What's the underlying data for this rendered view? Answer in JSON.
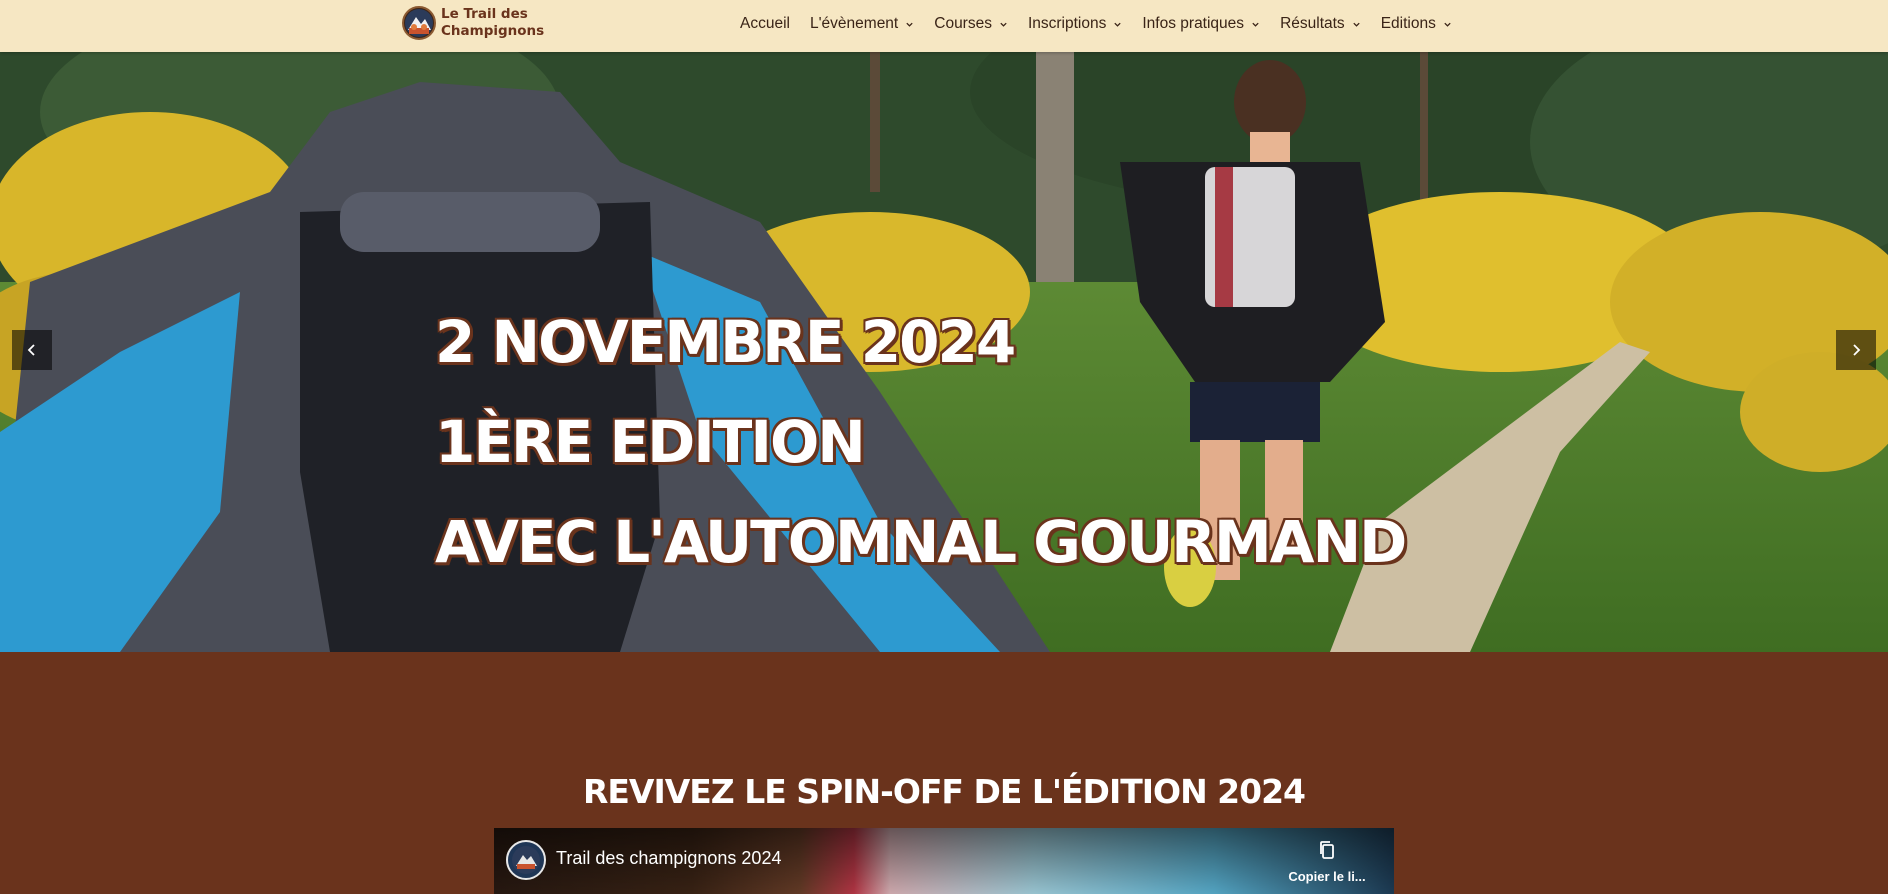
{
  "header": {
    "logo_text": "Le Trail des Champignons",
    "logo_icon": "trail-badge-icon",
    "nav": [
      {
        "label": "Accueil",
        "has_dropdown": false
      },
      {
        "label": "L'évènement",
        "has_dropdown": true
      },
      {
        "label": "Courses",
        "has_dropdown": true
      },
      {
        "label": "Inscriptions",
        "has_dropdown": true
      },
      {
        "label": "Infos pratiques",
        "has_dropdown": true
      },
      {
        "label": "Résultats",
        "has_dropdown": true
      },
      {
        "label": "Editions",
        "has_dropdown": true
      }
    ]
  },
  "hero": {
    "line1": "2 NOVEMBRE 2024",
    "line2": "1ÈRE EDITION",
    "line3": "AVEC L'AUTOMNAL GOURMAND",
    "prev_icon": "chevron-left-icon",
    "next_icon": "chevron-right-icon"
  },
  "section": {
    "title": "REVIVEZ LE SPIN-OFF DE L'ÉDITION 2024"
  },
  "video": {
    "title": "Trail des champignons 2024",
    "copy_label": "Copier le li...",
    "copy_icon": "copy-icon"
  },
  "colors": {
    "header_bg": "#f6e7c3",
    "brand_brown": "#6a331c",
    "nav_text": "#3a2417"
  }
}
